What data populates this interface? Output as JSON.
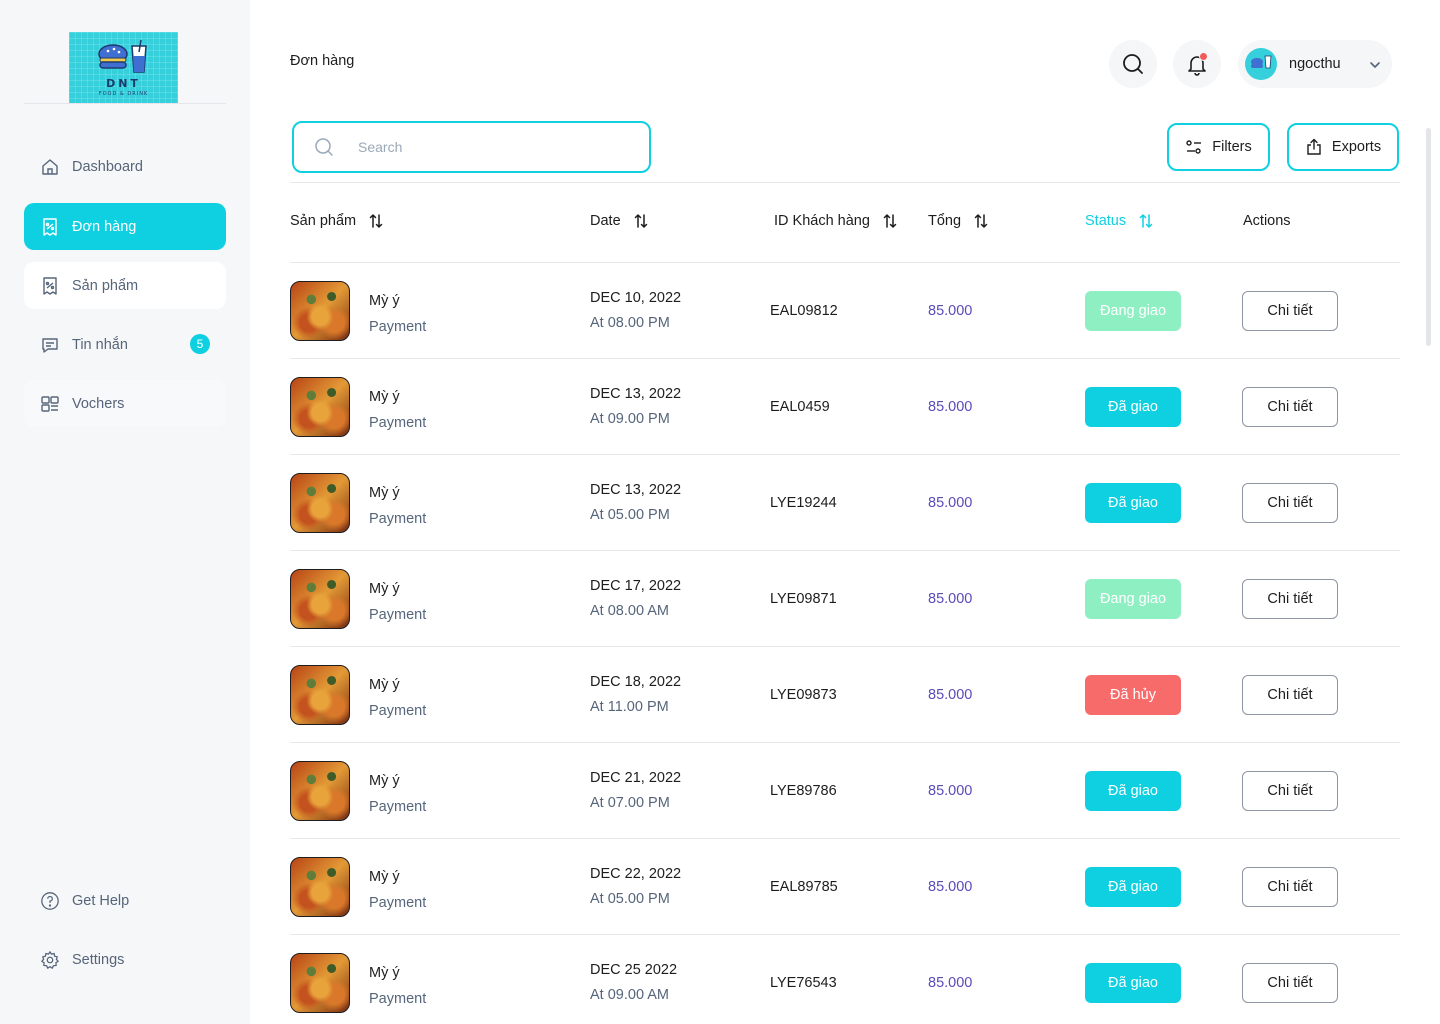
{
  "brand": {
    "title": "DNT",
    "subtitle": "FOOD & DRINK",
    "accent": "#0fd0e1"
  },
  "sidebar": {
    "items": [
      {
        "label": "Dashboard",
        "icon": "home-icon"
      },
      {
        "label": "Đơn hàng",
        "icon": "receipt-icon",
        "active": true
      },
      {
        "label": "Sản phẩm",
        "icon": "receipt-icon"
      },
      {
        "label": "Tin nhắn",
        "icon": "message-icon",
        "badge": "5"
      },
      {
        "label": "Vochers",
        "icon": "voucher-icon"
      }
    ],
    "bottom": [
      {
        "label": "Get Help",
        "icon": "help-icon"
      },
      {
        "label": "Settings",
        "icon": "gear-icon"
      }
    ]
  },
  "header": {
    "breadcrumb": "Đơn hàng",
    "user_name": "ngocthu"
  },
  "toolbar": {
    "search_placeholder": "Search",
    "filters_label": "Filters",
    "exports_label": "Exports"
  },
  "table": {
    "columns": [
      "Sản phẩm",
      "Date",
      "ID Khách hàng",
      "Tổng",
      "Status",
      "Actions"
    ],
    "action_label": "Chi tiết",
    "status_colors": {
      "Đang giao": "#8ef0c2",
      "Đã giao": "#0fd0e1",
      "Đã hủy": "#f76b6b"
    },
    "rows": [
      {
        "product": "Mỳ ý",
        "sub": "Payment",
        "date": "DEC 10, 2022",
        "time": "At 08.00 PM",
        "customer_id": "EAL09812",
        "total": "85.000",
        "status": "Đang giao"
      },
      {
        "product": "Mỳ ý",
        "sub": "Payment",
        "date": "DEC 13, 2022",
        "time": "At 09.00 PM",
        "customer_id": "EAL0459",
        "total": "85.000",
        "status": "Đã giao"
      },
      {
        "product": "Mỳ ý",
        "sub": "Payment",
        "date": "DEC 13, 2022",
        "time": "At 05.00 PM",
        "customer_id": "LYE19244",
        "total": "85.000",
        "status": "Đã giao"
      },
      {
        "product": "Mỳ ý",
        "sub": "Payment",
        "date": "DEC 17, 2022",
        "time": "At 08.00 AM",
        "customer_id": "LYE09871",
        "total": "85.000",
        "status": "Đang giao"
      },
      {
        "product": "Mỳ ý",
        "sub": "Payment",
        "date": "DEC 18, 2022",
        "time": "At 11.00 PM",
        "customer_id": "LYE09873",
        "total": "85.000",
        "status": "Đã hủy"
      },
      {
        "product": "Mỳ ý",
        "sub": "Payment",
        "date": "DEC 21, 2022",
        "time": "At 07.00 PM",
        "customer_id": "LYE89786",
        "total": "85.000",
        "status": "Đã giao"
      },
      {
        "product": "Mỳ ý",
        "sub": "Payment",
        "date": "DEC 22, 2022",
        "time": "At 05.00 PM",
        "customer_id": "EAL89785",
        "total": "85.000",
        "status": "Đã giao"
      },
      {
        "product": "Mỳ ý",
        "sub": "Payment",
        "date": "DEC 25 2022",
        "time": "At 09.00 AM",
        "customer_id": "LYE76543",
        "total": "85.000",
        "status": "Đã giao"
      }
    ]
  }
}
